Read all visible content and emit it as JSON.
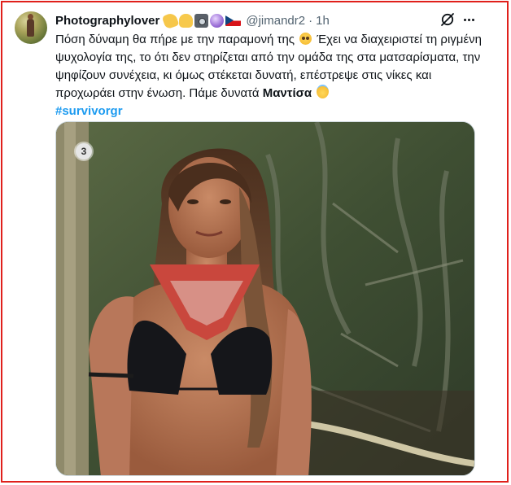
{
  "tweet": {
    "display_name": "Photographylover",
    "name_emojis": [
      "flexed-arm-icon",
      "ok-hand-icon",
      "camera-icon",
      "crystal-ball-icon",
      "czech-flag-icon"
    ],
    "handle": "@jimandr2",
    "separator": "·",
    "time": "1h",
    "text": {
      "line1_a": "Πόση δύναμη θα πήρε με την παραμονή της ",
      "line1_b": " Έχει να διαχειριστεί τη ριγμένη ψυχολογία της, το ότι δεν στηρίζεται από την ομάδα της στα ματσαρίσματα, την ψηφίζουν συνέχεια, κι όμως στέκεται δυνατή, επέστρεψε στις νίκες και προχωράει στην ένωση. Πάμε δυνατά ",
      "bold_name": "Μαντίσα",
      "hashtag": "#survivorgr"
    },
    "inline_emojis": [
      "pleading-face-icon",
      "smiling-face-with-halo-icon"
    ],
    "actions": {
      "grok": "grok-icon",
      "more": "more-options-icon"
    },
    "media": {
      "badge": "3",
      "description_icon": "photo"
    }
  },
  "colors": {
    "text_primary": "#0f1419",
    "text_secondary": "#536471",
    "link": "#1d9bf0",
    "frame_border": "#e0201b"
  }
}
